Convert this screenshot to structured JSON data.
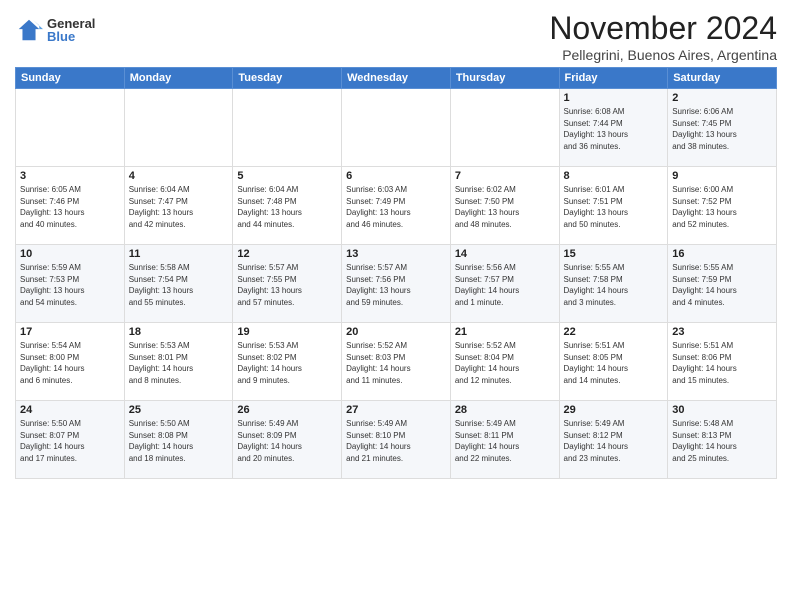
{
  "header": {
    "logo_general": "General",
    "logo_blue": "Blue",
    "title": "November 2024",
    "subtitle": "Pellegrini, Buenos Aires, Argentina"
  },
  "weekdays": [
    "Sunday",
    "Monday",
    "Tuesday",
    "Wednesday",
    "Thursday",
    "Friday",
    "Saturday"
  ],
  "weeks": [
    [
      {
        "day": "",
        "info": ""
      },
      {
        "day": "",
        "info": ""
      },
      {
        "day": "",
        "info": ""
      },
      {
        "day": "",
        "info": ""
      },
      {
        "day": "",
        "info": ""
      },
      {
        "day": "1",
        "info": "Sunrise: 6:08 AM\nSunset: 7:44 PM\nDaylight: 13 hours\nand 36 minutes."
      },
      {
        "day": "2",
        "info": "Sunrise: 6:06 AM\nSunset: 7:45 PM\nDaylight: 13 hours\nand 38 minutes."
      }
    ],
    [
      {
        "day": "3",
        "info": "Sunrise: 6:05 AM\nSunset: 7:46 PM\nDaylight: 13 hours\nand 40 minutes."
      },
      {
        "day": "4",
        "info": "Sunrise: 6:04 AM\nSunset: 7:47 PM\nDaylight: 13 hours\nand 42 minutes."
      },
      {
        "day": "5",
        "info": "Sunrise: 6:04 AM\nSunset: 7:48 PM\nDaylight: 13 hours\nand 44 minutes."
      },
      {
        "day": "6",
        "info": "Sunrise: 6:03 AM\nSunset: 7:49 PM\nDaylight: 13 hours\nand 46 minutes."
      },
      {
        "day": "7",
        "info": "Sunrise: 6:02 AM\nSunset: 7:50 PM\nDaylight: 13 hours\nand 48 minutes."
      },
      {
        "day": "8",
        "info": "Sunrise: 6:01 AM\nSunset: 7:51 PM\nDaylight: 13 hours\nand 50 minutes."
      },
      {
        "day": "9",
        "info": "Sunrise: 6:00 AM\nSunset: 7:52 PM\nDaylight: 13 hours\nand 52 minutes."
      }
    ],
    [
      {
        "day": "10",
        "info": "Sunrise: 5:59 AM\nSunset: 7:53 PM\nDaylight: 13 hours\nand 54 minutes."
      },
      {
        "day": "11",
        "info": "Sunrise: 5:58 AM\nSunset: 7:54 PM\nDaylight: 13 hours\nand 55 minutes."
      },
      {
        "day": "12",
        "info": "Sunrise: 5:57 AM\nSunset: 7:55 PM\nDaylight: 13 hours\nand 57 minutes."
      },
      {
        "day": "13",
        "info": "Sunrise: 5:57 AM\nSunset: 7:56 PM\nDaylight: 13 hours\nand 59 minutes."
      },
      {
        "day": "14",
        "info": "Sunrise: 5:56 AM\nSunset: 7:57 PM\nDaylight: 14 hours\nand 1 minute."
      },
      {
        "day": "15",
        "info": "Sunrise: 5:55 AM\nSunset: 7:58 PM\nDaylight: 14 hours\nand 3 minutes."
      },
      {
        "day": "16",
        "info": "Sunrise: 5:55 AM\nSunset: 7:59 PM\nDaylight: 14 hours\nand 4 minutes."
      }
    ],
    [
      {
        "day": "17",
        "info": "Sunrise: 5:54 AM\nSunset: 8:00 PM\nDaylight: 14 hours\nand 6 minutes."
      },
      {
        "day": "18",
        "info": "Sunrise: 5:53 AM\nSunset: 8:01 PM\nDaylight: 14 hours\nand 8 minutes."
      },
      {
        "day": "19",
        "info": "Sunrise: 5:53 AM\nSunset: 8:02 PM\nDaylight: 14 hours\nand 9 minutes."
      },
      {
        "day": "20",
        "info": "Sunrise: 5:52 AM\nSunset: 8:03 PM\nDaylight: 14 hours\nand 11 minutes."
      },
      {
        "day": "21",
        "info": "Sunrise: 5:52 AM\nSunset: 8:04 PM\nDaylight: 14 hours\nand 12 minutes."
      },
      {
        "day": "22",
        "info": "Sunrise: 5:51 AM\nSunset: 8:05 PM\nDaylight: 14 hours\nand 14 minutes."
      },
      {
        "day": "23",
        "info": "Sunrise: 5:51 AM\nSunset: 8:06 PM\nDaylight: 14 hours\nand 15 minutes."
      }
    ],
    [
      {
        "day": "24",
        "info": "Sunrise: 5:50 AM\nSunset: 8:07 PM\nDaylight: 14 hours\nand 17 minutes."
      },
      {
        "day": "25",
        "info": "Sunrise: 5:50 AM\nSunset: 8:08 PM\nDaylight: 14 hours\nand 18 minutes."
      },
      {
        "day": "26",
        "info": "Sunrise: 5:49 AM\nSunset: 8:09 PM\nDaylight: 14 hours\nand 20 minutes."
      },
      {
        "day": "27",
        "info": "Sunrise: 5:49 AM\nSunset: 8:10 PM\nDaylight: 14 hours\nand 21 minutes."
      },
      {
        "day": "28",
        "info": "Sunrise: 5:49 AM\nSunset: 8:11 PM\nDaylight: 14 hours\nand 22 minutes."
      },
      {
        "day": "29",
        "info": "Sunrise: 5:49 AM\nSunset: 8:12 PM\nDaylight: 14 hours\nand 23 minutes."
      },
      {
        "day": "30",
        "info": "Sunrise: 5:48 AM\nSunset: 8:13 PM\nDaylight: 14 hours\nand 25 minutes."
      }
    ]
  ]
}
